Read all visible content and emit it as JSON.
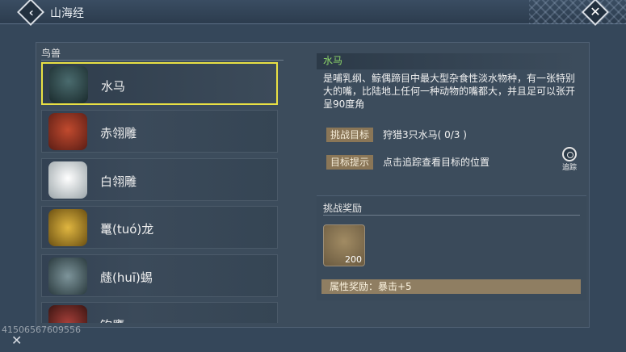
{
  "topbar": {
    "back_icon": "chevron-left-icon",
    "title": "山海经",
    "close_icon": "close-icon"
  },
  "list": {
    "header": "鸟兽",
    "items": [
      {
        "label": "水马",
        "selected": true,
        "icon": "water-horse-portrait",
        "color": "#1f4a4c"
      },
      {
        "label": "赤翎雕",
        "selected": false,
        "icon": "red-eagle-portrait",
        "color": "#8e2d20"
      },
      {
        "label": "白翎雕",
        "selected": false,
        "icon": "white-eagle-portrait",
        "color": "#e9eef0"
      },
      {
        "label": "鼍(tuó)龙",
        "selected": false,
        "icon": "crocodile-portrait",
        "color": "#b88c2a"
      },
      {
        "label": "䖛(huī)蜴",
        "selected": false,
        "icon": "lizard-portrait",
        "color": "#4c6268"
      },
      {
        "label": "钩鹰",
        "selected": false,
        "icon": "hook-hawk-portrait",
        "color": "#7a2b26"
      }
    ]
  },
  "detail": {
    "name": "水马",
    "description": "是哺乳纲、鲸偶蹄目中最大型杂食性淡水物种，有一张特别大的嘴，比陆地上任何一种动物的嘴都大，并且足可以张开呈90度角",
    "challenge_tag": "挑战目标",
    "challenge_text": "狩猎3只水马( 0/3 )",
    "hint_tag": "目标提示",
    "hint_text": "点击追踪查看目标的位置",
    "track_label": "追踪"
  },
  "rewards": {
    "title": "挑战奖励",
    "item_count": "200",
    "attribute": "属性奖励：暴击+5"
  },
  "footer": {
    "uid": "41506567609556"
  }
}
